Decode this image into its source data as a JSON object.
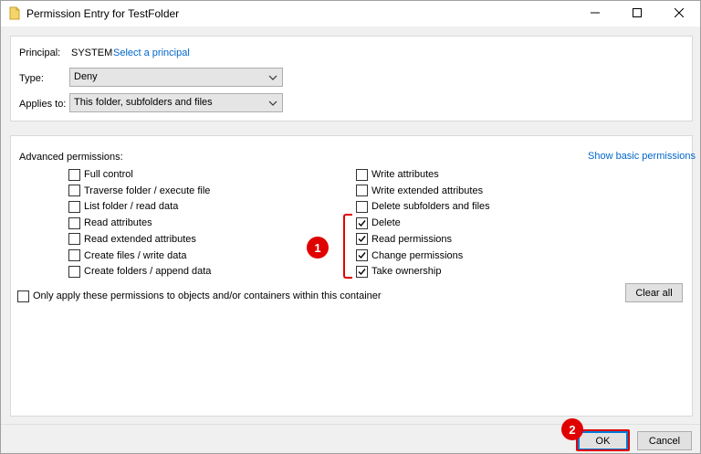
{
  "window": {
    "title": "Permission Entry for TestFolder",
    "icons": {
      "app": "folder-icon",
      "minimize": "minimize-icon",
      "maximize": "maximize-icon",
      "close": "close-icon"
    }
  },
  "principal": {
    "label": "Principal:",
    "value": "SYSTEM",
    "link": "Select a principal"
  },
  "type": {
    "label": "Type:",
    "value": "Deny"
  },
  "applies_to": {
    "label": "Applies to:",
    "value": "This folder, subfolders and files"
  },
  "advanced": {
    "title": "Advanced permissions:",
    "show_basic_link": "Show basic permissions",
    "left": [
      {
        "label": "Full control",
        "checked": false
      },
      {
        "label": "Traverse folder / execute file",
        "checked": false
      },
      {
        "label": "List folder / read data",
        "checked": false
      },
      {
        "label": "Read attributes",
        "checked": false
      },
      {
        "label": "Read extended attributes",
        "checked": false
      },
      {
        "label": "Create files / write data",
        "checked": false
      },
      {
        "label": "Create folders / append data",
        "checked": false
      }
    ],
    "right": [
      {
        "label": "Write attributes",
        "checked": false
      },
      {
        "label": "Write extended attributes",
        "checked": false
      },
      {
        "label": "Delete subfolders and files",
        "checked": false
      },
      {
        "label": "Delete",
        "checked": true
      },
      {
        "label": "Read permissions",
        "checked": true
      },
      {
        "label": "Change permissions",
        "checked": true
      },
      {
        "label": "Take ownership",
        "checked": true
      }
    ],
    "only_apply": {
      "label": "Only apply these permissions to objects and/or containers within this container",
      "checked": false
    },
    "clear_all": "Clear all"
  },
  "buttons": {
    "ok": "OK",
    "cancel": "Cancel"
  },
  "annotations": {
    "badge1": "1",
    "badge2": "2",
    "color": "#e00000"
  }
}
